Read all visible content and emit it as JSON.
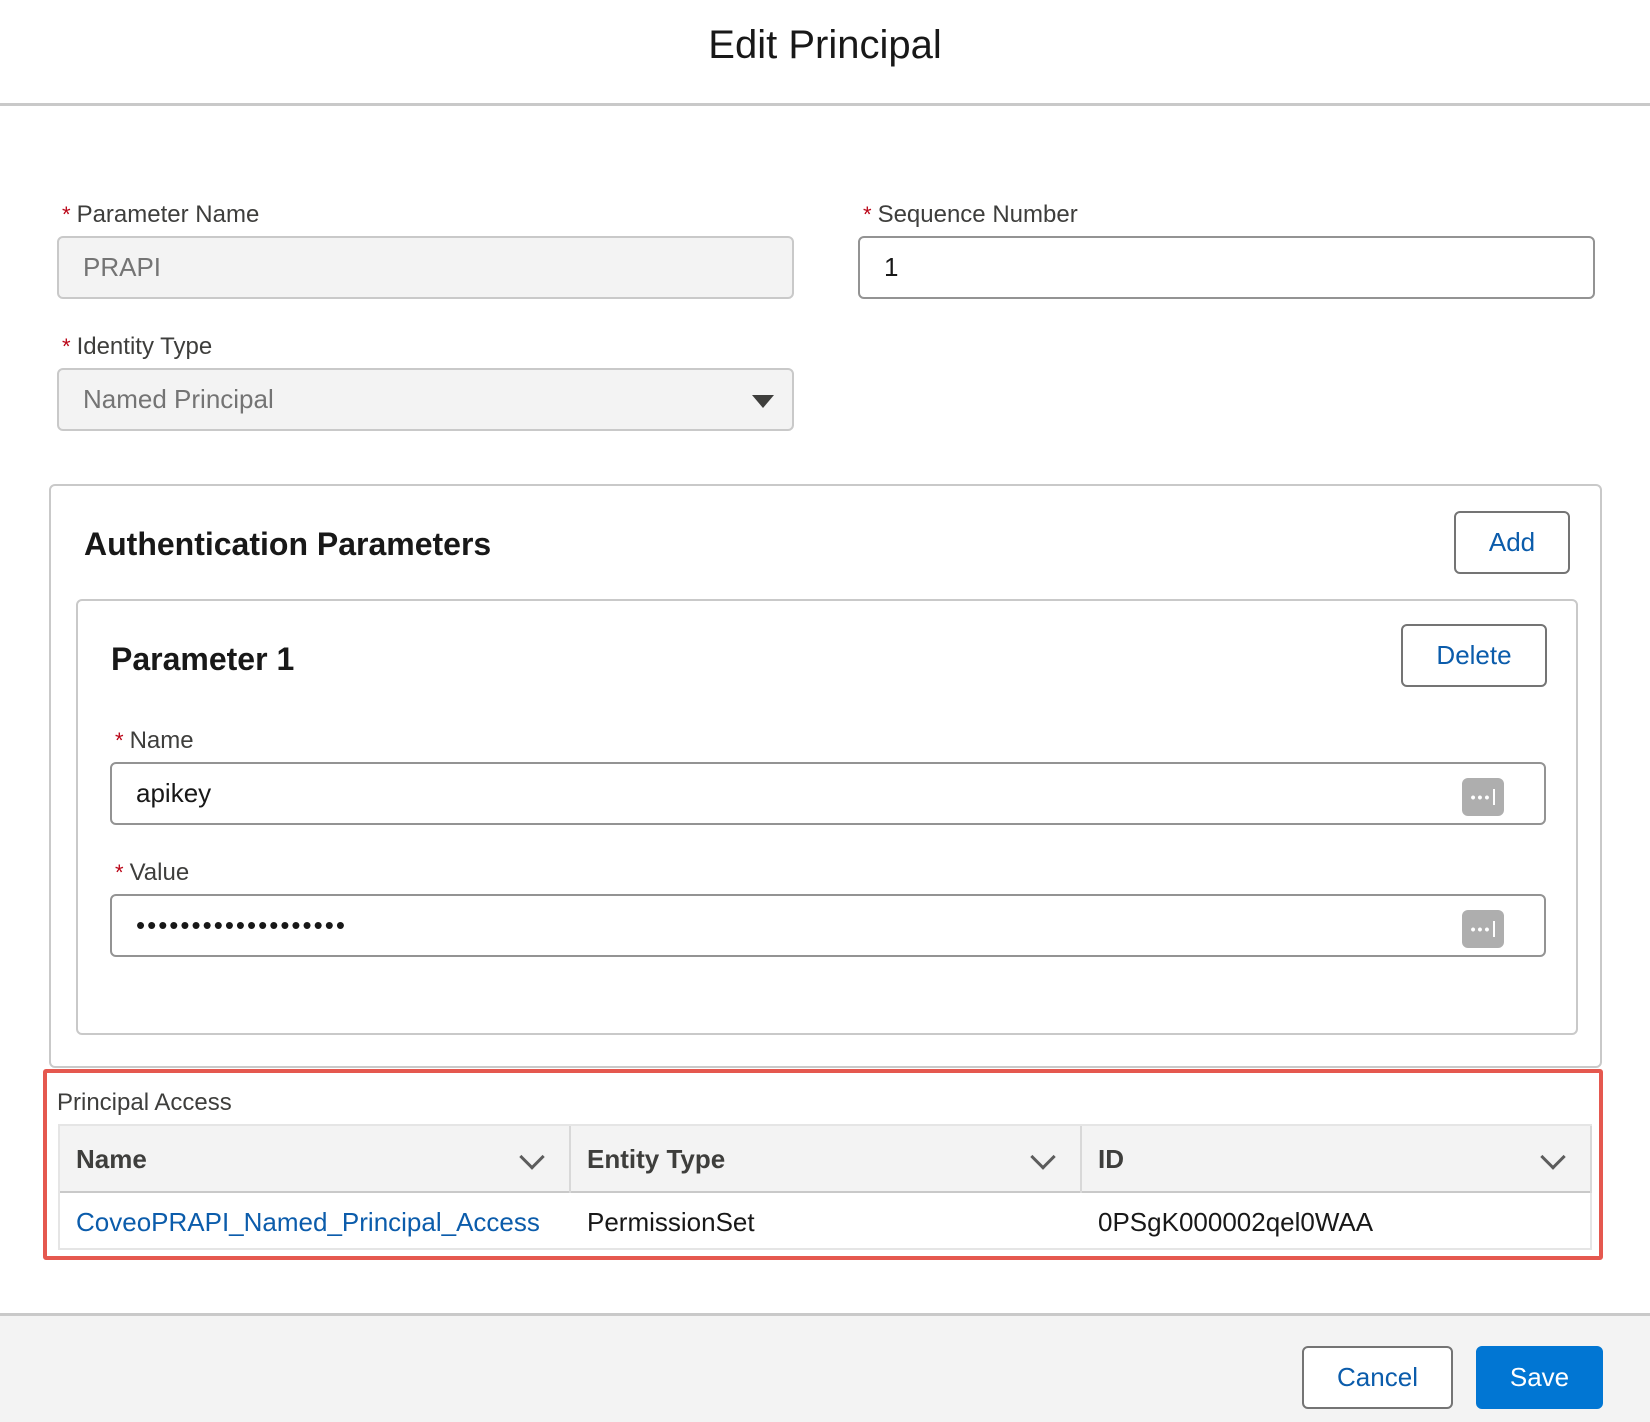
{
  "header": {
    "title": "Edit Principal"
  },
  "form": {
    "parameter_name": {
      "label": "Parameter Name",
      "value": "PRAPI"
    },
    "sequence_number": {
      "label": "Sequence Number",
      "value": "1"
    },
    "identity_type": {
      "label": "Identity Type",
      "value": "Named Principal"
    }
  },
  "auth": {
    "title": "Authentication Parameters",
    "add_label": "Add",
    "param": {
      "title": "Parameter 1",
      "delete_label": "Delete",
      "name_label": "Name",
      "name_value": "apikey",
      "value_label": "Value",
      "value_masked": "•••••••••••••••••••"
    }
  },
  "access": {
    "label": "Principal Access",
    "columns": [
      "Name",
      "Entity Type",
      "ID"
    ],
    "rows": [
      {
        "name": "CoveoPRAPI_Named_Principal_Access",
        "entity_type": "PermissionSet",
        "id": "0PSgK000002qel0WAA"
      }
    ]
  },
  "footer": {
    "cancel_label": "Cancel",
    "save_label": "Save"
  },
  "colors": {
    "brand": "#0176d3",
    "link": "#0b5cab",
    "required": "#ba0517",
    "highlight": "#e5584f"
  }
}
